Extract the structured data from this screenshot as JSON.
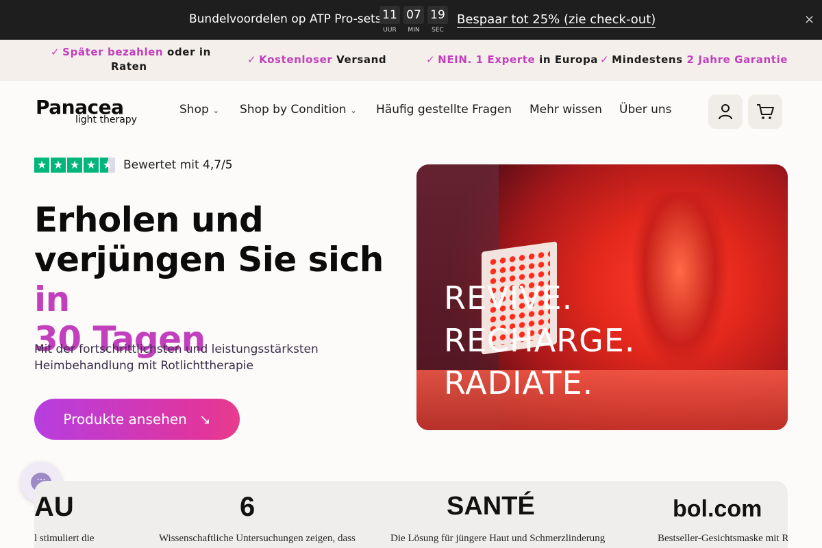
{
  "announcement": {
    "text": "Bundelvoordelen op ATP Pro-sets",
    "timer": [
      {
        "value": "11",
        "unit": "UUR"
      },
      {
        "value": "07",
        "unit": "MIN"
      },
      {
        "value": "19",
        "unit": "SEC"
      }
    ],
    "link": "Bespaar tot 25% (zie check-out)",
    "close_icon": "×"
  },
  "benefits": [
    {
      "highlight": "Später bezahlen",
      "rest": " oder in",
      "line2": "Raten"
    },
    {
      "highlight": "Kostenloser",
      "rest": " Versand"
    },
    {
      "highlight": "NEIN. 1 Experte",
      "rest": " in Europa"
    },
    {
      "prefix": "Mindestens ",
      "highlight": "2 Jahre Garantie"
    }
  ],
  "check_icon": "✓",
  "header": {
    "logo_main": "Panacea",
    "logo_sub": "light therapy",
    "nav": [
      {
        "label": "Shop",
        "has_dropdown": true
      },
      {
        "label": "Shop by Condition",
        "has_dropdown": true
      },
      {
        "label": "Häufig gestellte Fragen",
        "has_dropdown": false
      },
      {
        "label": "Mehr wissen",
        "has_dropdown": false
      },
      {
        "label": "Über uns",
        "has_dropdown": false
      }
    ],
    "icons": [
      "account-icon",
      "cart-icon"
    ]
  },
  "hero": {
    "rating_prefix": "Bewertet mit ",
    "rating_value": "4,7/5",
    "stars": 4.5,
    "title_line1": "Erholen und",
    "title_line2": "verjüngen Sie sich ",
    "title_accent_a": "in",
    "title_accent_b": "30 Tagen",
    "subtitle": "Mit der fortschrittlichsten und leistungsstärksten Heimbehandlung mit Rotlichttherapie",
    "cta_label": "Produkte ansehen",
    "cta_icon": "↘",
    "image_lines": [
      "REVIVE.",
      "RECHARGE.",
      "RADIATE."
    ]
  },
  "press": [
    {
      "logo": "AU",
      "quote": "l stimuliert die"
    },
    {
      "logo": "6",
      "quote": "Wissenschaftliche Untersuchungen zeigen, dass"
    },
    {
      "logo": "SANTÉ",
      "quote": "Die Lösung für jüngere Haut und Schmerzlinderung"
    },
    {
      "logo": "bol.com",
      "quote": "Bestseller-Gesichtsmaske mit Rot"
    }
  ],
  "colors": {
    "accent": "#c23fbd",
    "announcement_bg": "#1e1e1e",
    "benefits_bg": "#f4efea",
    "trustpilot": "#00b67a"
  }
}
